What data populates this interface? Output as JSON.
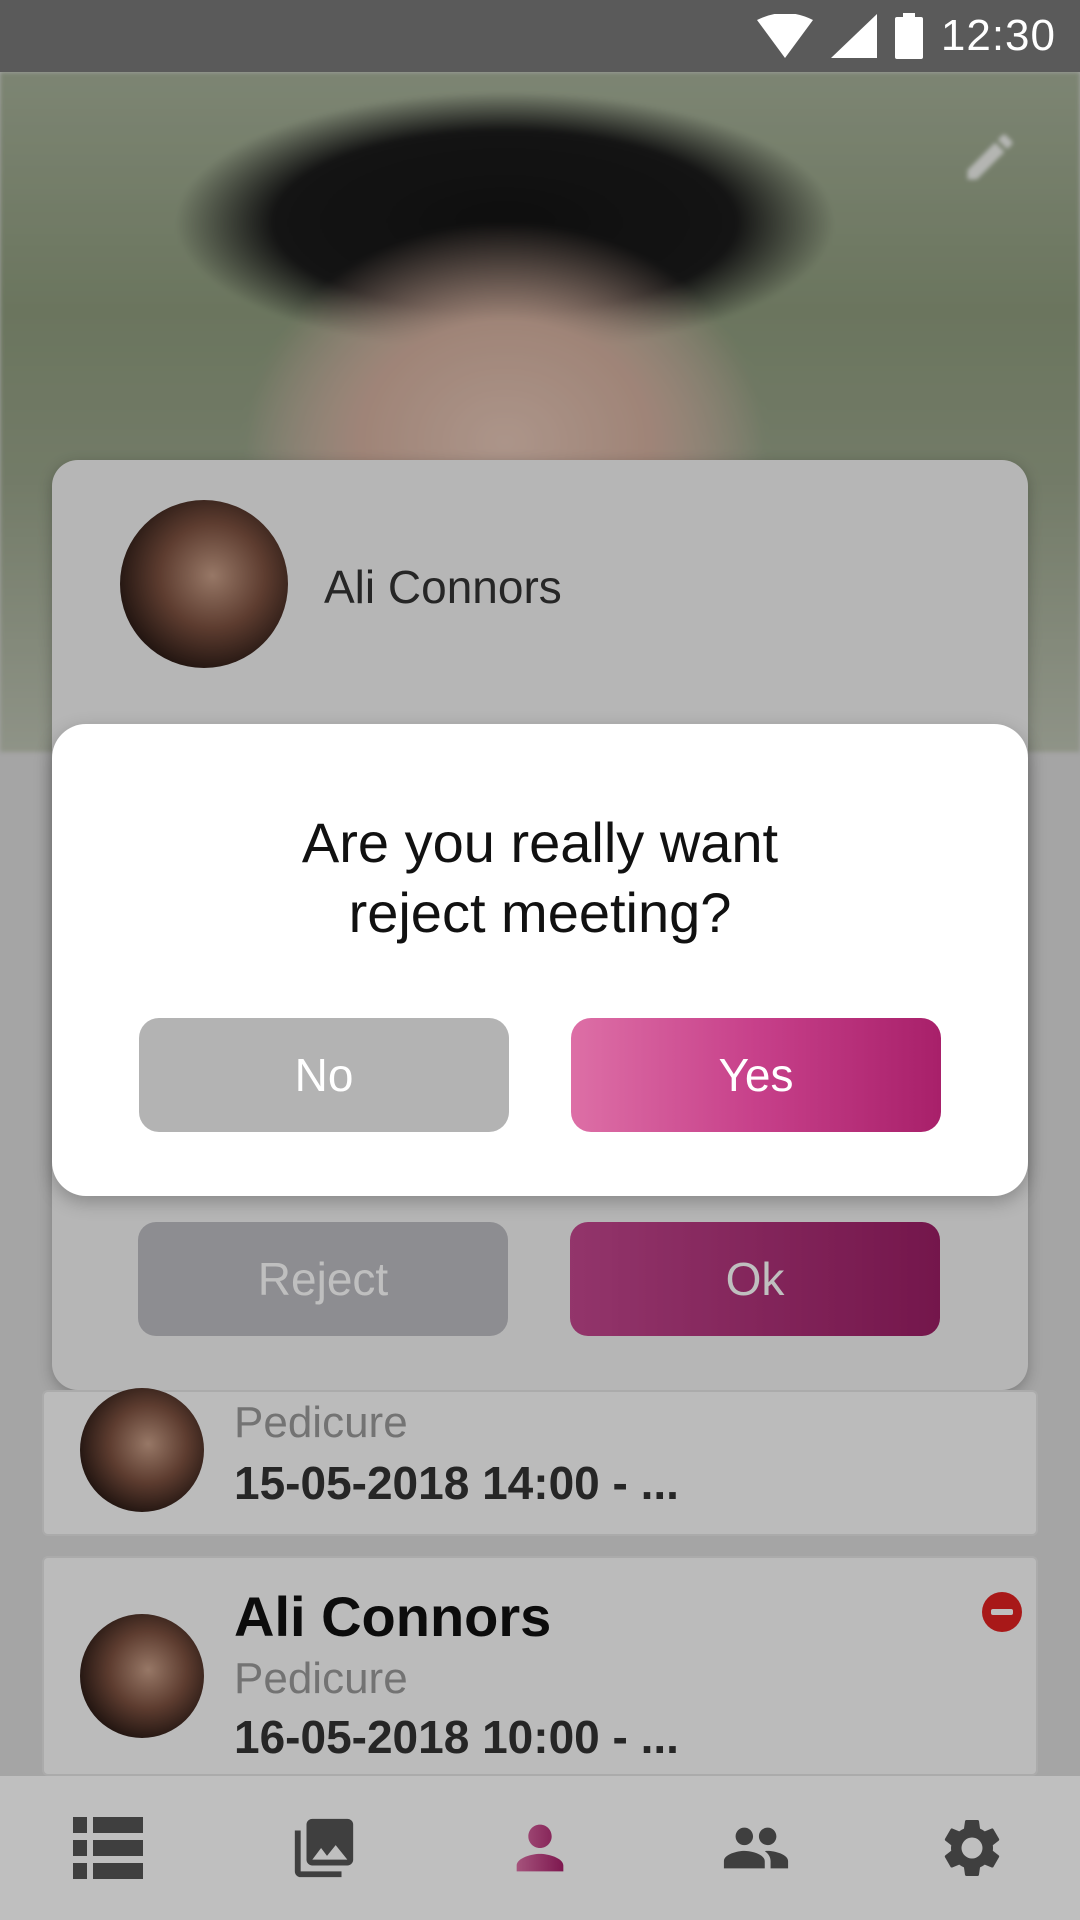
{
  "status_bar": {
    "time": "12:30"
  },
  "profile": {
    "name": "Ali Connors"
  },
  "dialog": {
    "message_line1": "Are you really want",
    "message_line2": "reject meeting?",
    "no_label": "No",
    "yes_label": "Yes"
  },
  "background_actions": {
    "reject_label": "Reject",
    "ok_label": "Ok"
  },
  "meetings": [
    {
      "name": "",
      "service": "Pedicure",
      "datetime": "15-05-2018 14:00 - ..."
    },
    {
      "name": "Ali Connors",
      "service": "Pedicure",
      "datetime": "16-05-2018 10:00 - ..."
    }
  ],
  "bottom_nav": {
    "items": [
      {
        "icon": "list-icon",
        "active": false
      },
      {
        "icon": "gallery-icon",
        "active": false
      },
      {
        "icon": "person-icon",
        "active": true
      },
      {
        "icon": "group-icon",
        "active": false
      },
      {
        "icon": "gear-icon",
        "active": false
      }
    ]
  },
  "colors": {
    "accent": "#c7408a",
    "accent_dark": "#a8206a",
    "no_button": "#b3b3b3"
  }
}
